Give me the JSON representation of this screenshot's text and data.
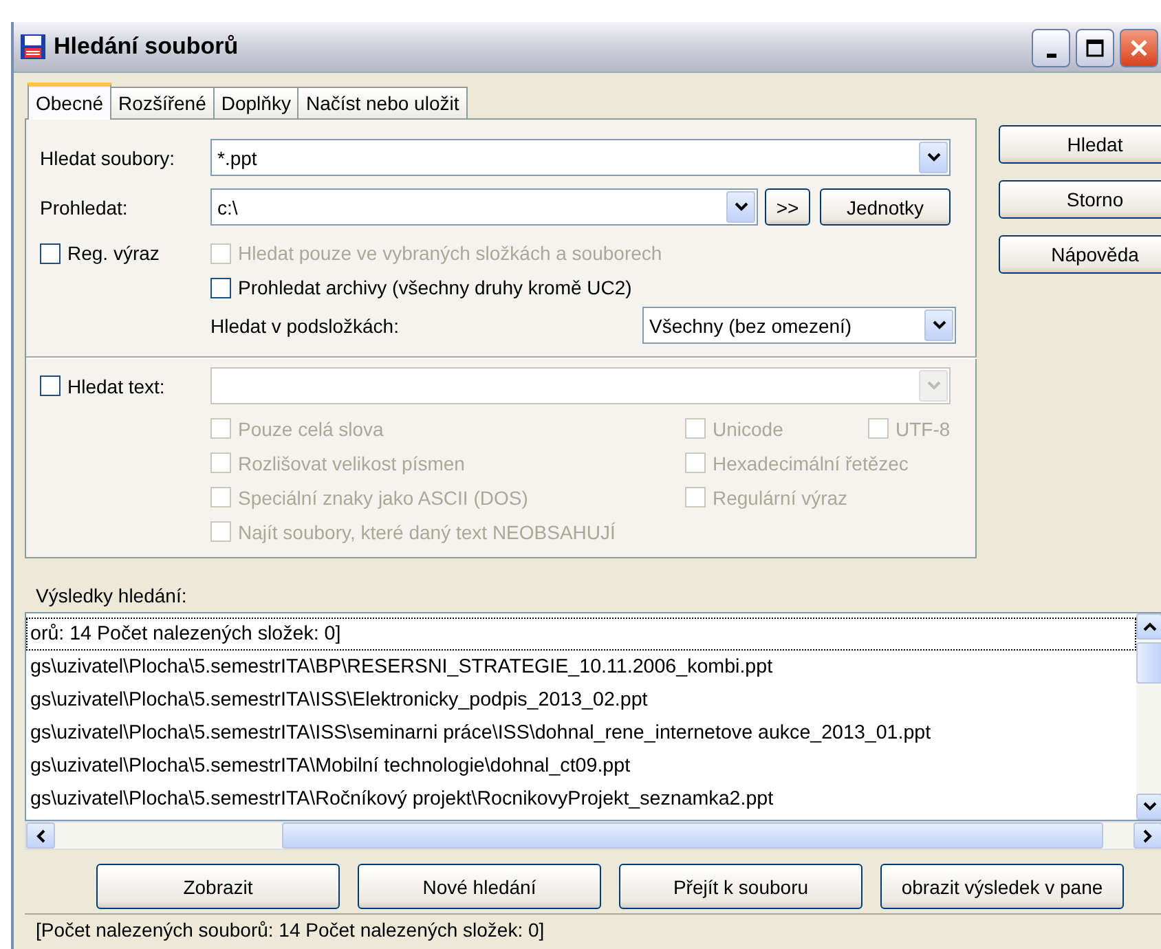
{
  "window": {
    "title": "Hledání souborů"
  },
  "tabs": [
    {
      "label": "Obecné",
      "selected": true
    },
    {
      "label": "Rozšířené",
      "selected": false
    },
    {
      "label": "Doplňky",
      "selected": false
    },
    {
      "label": "Načíst nebo uložit",
      "selected": false
    }
  ],
  "search_files": {
    "label": "Hledat soubory:",
    "value": "*.ppt"
  },
  "search_in": {
    "label": "Prohledat:",
    "value": "c:\\",
    "more_button": ">>",
    "drives_button": "Jednotky"
  },
  "regex": {
    "label": "Reg. výraz",
    "checked": false,
    "disabled": false
  },
  "only_selected": {
    "label": "Hledat pouze ve vybraných složkách a souborech",
    "checked": false,
    "disabled": true
  },
  "archives": {
    "label": "Prohledat archivy (všechny druhy kromě UC2)",
    "checked": false,
    "disabled": false
  },
  "subfolders": {
    "label": "Hledat v podsložkách:",
    "value": "Všechny (bez omezení)"
  },
  "find_text": {
    "label": "Hledat text:",
    "checked": false,
    "disabled": false,
    "field_disabled": true
  },
  "text_options": [
    {
      "items": [
        {
          "label": "Pouze celá slova",
          "checked": false,
          "disabled": true
        },
        {
          "label": "Unicode",
          "checked": false,
          "disabled": true
        },
        {
          "label": "UTF-8",
          "checked": false,
          "disabled": true
        }
      ]
    },
    {
      "items": [
        {
          "label": "Rozlišovat velikost písmen",
          "checked": false,
          "disabled": true
        },
        {
          "label": "Hexadecimální řetězec",
          "checked": false,
          "disabled": true
        }
      ]
    },
    {
      "items": [
        {
          "label": "Speciální znaky jako ASCII (DOS)",
          "checked": false,
          "disabled": true
        },
        {
          "label": "Regulární výraz",
          "checked": false,
          "disabled": true
        }
      ]
    },
    {
      "items": [
        {
          "label": "Najít soubory, které daný text NEOBSAHUJÍ",
          "checked": false,
          "disabled": true
        }
      ]
    }
  ],
  "side_buttons": [
    "Hledat",
    "Storno",
    "Nápověda"
  ],
  "results": {
    "label": "Výsledky hledání:",
    "rows": [
      {
        "text": "orů: 14   Počet nalezených složek: 0]",
        "focused": true
      },
      {
        "text": "gs\\uzivatel\\Plocha\\5.semestrITA\\BP\\RESERSNI_STRATEGIE_10.11.2006_kombi.ppt",
        "focused": false
      },
      {
        "text": "gs\\uzivatel\\Plocha\\5.semestrITA\\ISS\\Elektronicky_podpis_2013_02.ppt",
        "focused": false
      },
      {
        "text": "gs\\uzivatel\\Plocha\\5.semestrITA\\ISS\\seminarni práce\\ISS\\dohnal_rene_internetove aukce_2013_01.ppt",
        "focused": false
      },
      {
        "text": "gs\\uzivatel\\Plocha\\5.semestrITA\\Mobilní technologie\\dohnal_ct09.ppt",
        "focused": false
      },
      {
        "text": "gs\\uzivatel\\Plocha\\5.semestrITA\\Ročníkový projekt\\RocnikovyProjekt_seznamka2.ppt",
        "focused": false
      }
    ]
  },
  "bottom_buttons": [
    "Zobrazit",
    "Nové hledání",
    "Přejít k souboru",
    "obrazit výsledek v pane"
  ],
  "status_bar": "[Počet nalezených souborů: 14   Počet nalezených složek: 0]"
}
